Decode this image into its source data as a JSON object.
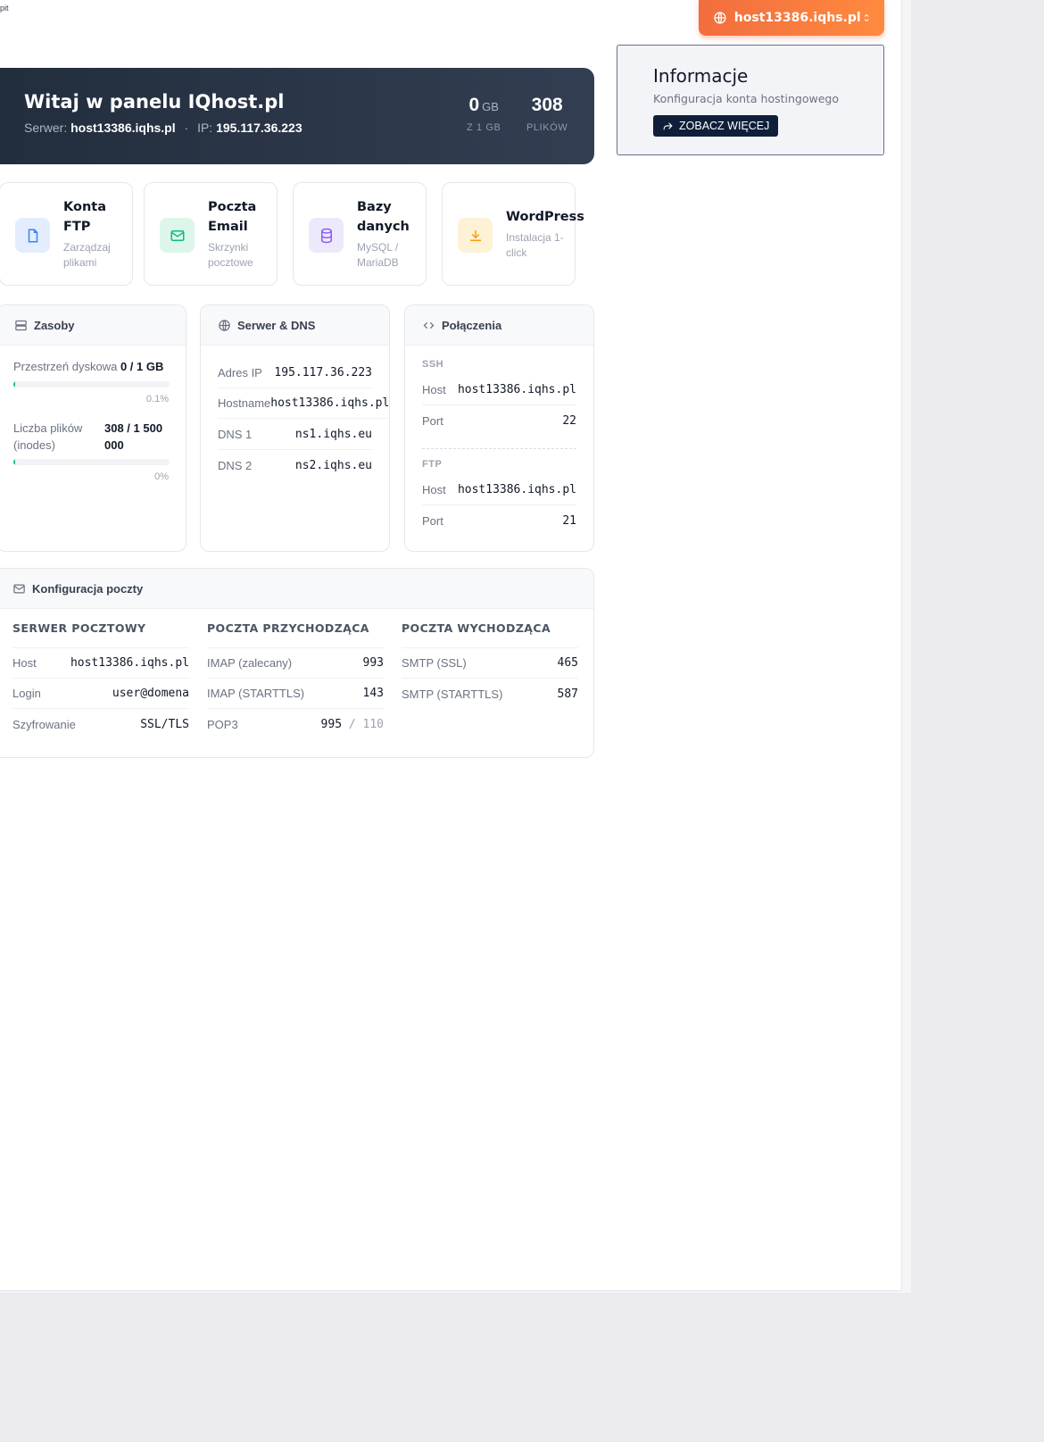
{
  "breadcrumb": "pit",
  "host_selector": {
    "label": "host13386.iqhs.pl"
  },
  "hero": {
    "title": "Witaj w panelu IQhost.pl",
    "server_label": "Serwer:",
    "server": "host13386.iqhs.pl",
    "separator": "·",
    "ip_label": "IP:",
    "ip": "195.117.36.223",
    "disk_value": "0",
    "disk_unit": "GB",
    "disk_caption": "Z 1 GB",
    "files_value": "308",
    "files_caption": "PLIKÓW"
  },
  "info": {
    "title": "Informacje",
    "subtitle": "Konfiguracja konta hostingowego",
    "button": "ZOBACZ WIĘCEJ"
  },
  "quick": [
    {
      "title": "Konta FTP",
      "subtitle": "Zarządzaj plikami"
    },
    {
      "title": "Poczta Email",
      "subtitle": "Skrzynki pocztowe"
    },
    {
      "title": "Bazy danych",
      "subtitle": "MySQL / MariaDB"
    },
    {
      "title": "WordPress",
      "subtitle": "Instalacja 1-click"
    }
  ],
  "resources": {
    "title": "Zasoby",
    "disk_label": "Przestrzeń dyskowa",
    "disk_value": "0 / 1 GB",
    "disk_fraction": 0.001,
    "disk_pct": "0.1%",
    "inodes_label": "Liczba plików (inodes)",
    "inodes_value": "308 / 1 500 000",
    "inodes_fraction": 0.0002,
    "inodes_pct": "0%"
  },
  "dns": {
    "title": "Serwer & DNS",
    "rows": [
      {
        "k": "Adres IP",
        "v": "195.117.36.223"
      },
      {
        "k": "Hostname",
        "v": "host13386.iqhs.pl"
      },
      {
        "k": "DNS 1",
        "v": "ns1.iqhs.eu"
      },
      {
        "k": "DNS 2",
        "v": "ns2.iqhs.eu"
      }
    ]
  },
  "connections": {
    "title": "Połączenia",
    "ssh_label": "SSH",
    "ssh_host_k": "Host",
    "ssh_host_v": "host13386.iqhs.pl",
    "ssh_port_k": "Port",
    "ssh_port_v": "22",
    "ftp_label": "FTP",
    "ftp_host_k": "Host",
    "ftp_host_v": "host13386.iqhs.pl",
    "ftp_port_k": "Port",
    "ftp_port_v": "21"
  },
  "mail": {
    "title": "Konfiguracja poczty",
    "server_head": "SERWER POCZTOWY",
    "incoming_head": "POCZTA PRZYCHODZĄCA",
    "outgoing_head": "POCZTA WYCHODZĄCA",
    "server": [
      {
        "k": "Host",
        "v": "host13386.iqhs.pl"
      },
      {
        "k": "Login",
        "v": "user@domena"
      },
      {
        "k": "Szyfrowanie",
        "v": "SSL/TLS"
      }
    ],
    "incoming": [
      {
        "k": "IMAP (zalecany)",
        "v": "993"
      },
      {
        "k": "IMAP (STARTTLS)",
        "v": "143"
      },
      {
        "k": "POP3",
        "v": "995",
        "alt": "/ 110"
      }
    ],
    "outgoing": [
      {
        "k": "SMTP (SSL)",
        "v": "465"
      },
      {
        "k": "SMTP (STARTTLS)",
        "v": "587"
      }
    ]
  },
  "colors": {
    "accent": "#f26d3d",
    "hero": "#222d3d",
    "navy_button": "#0f1f3a",
    "progress": "#19b79a"
  }
}
